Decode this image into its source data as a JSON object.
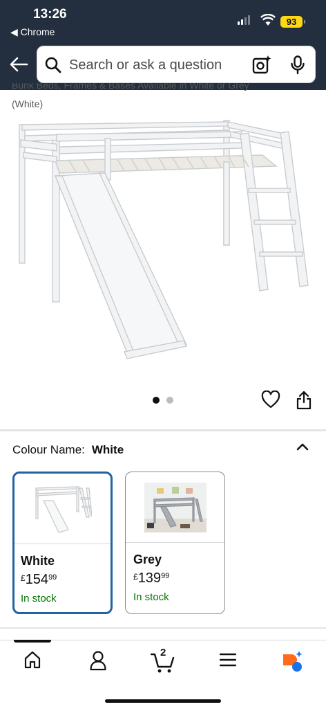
{
  "status_bar": {
    "time": "13:26",
    "back_app": "◀ Chrome",
    "battery": "93"
  },
  "header": {
    "search_placeholder": "Search or ask a question"
  },
  "product": {
    "title_partial": "Bunk Beds, Frames & Bases Available in White or Grey",
    "variant": "(White)",
    "image_count": 2,
    "current_image": 1
  },
  "colour": {
    "label": "Colour Name:",
    "selected": "White",
    "options": [
      {
        "name": "White",
        "price_symbol": "£",
        "price_whole": "154",
        "price_fraction": "99",
        "stock": "In stock",
        "selected": true
      },
      {
        "name": "Grey",
        "price_symbol": "£",
        "price_whole": "139",
        "price_fraction": "99",
        "stock": "In stock",
        "selected": false
      }
    ]
  },
  "bottom_nav": {
    "items": [
      "home-icon",
      "account-icon",
      "cart-icon",
      "menu-icon",
      "rufus-icon"
    ],
    "cart_count": "2"
  },
  "colors": {
    "header_bg": "#232f3e",
    "selected_border": "#2162a1",
    "in_stock": "#007600",
    "battery": "#ffd814"
  }
}
